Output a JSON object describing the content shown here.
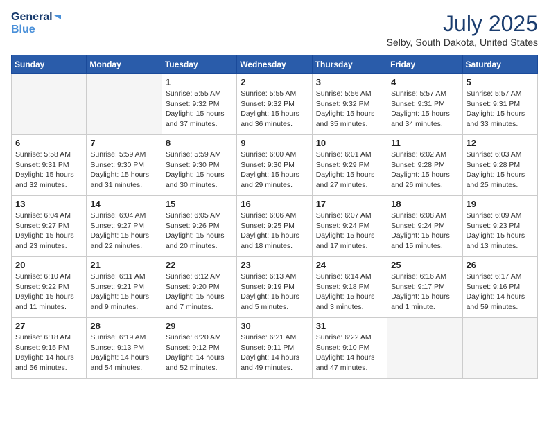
{
  "logo": {
    "line1": "General",
    "line2": "Blue"
  },
  "title": "July 2025",
  "location": "Selby, South Dakota, United States",
  "days_of_week": [
    "Sunday",
    "Monday",
    "Tuesday",
    "Wednesday",
    "Thursday",
    "Friday",
    "Saturday"
  ],
  "weeks": [
    [
      {
        "day": "",
        "info": ""
      },
      {
        "day": "",
        "info": ""
      },
      {
        "day": "1",
        "info": "Sunrise: 5:55 AM\nSunset: 9:32 PM\nDaylight: 15 hours\nand 37 minutes."
      },
      {
        "day": "2",
        "info": "Sunrise: 5:55 AM\nSunset: 9:32 PM\nDaylight: 15 hours\nand 36 minutes."
      },
      {
        "day": "3",
        "info": "Sunrise: 5:56 AM\nSunset: 9:32 PM\nDaylight: 15 hours\nand 35 minutes."
      },
      {
        "day": "4",
        "info": "Sunrise: 5:57 AM\nSunset: 9:31 PM\nDaylight: 15 hours\nand 34 minutes."
      },
      {
        "day": "5",
        "info": "Sunrise: 5:57 AM\nSunset: 9:31 PM\nDaylight: 15 hours\nand 33 minutes."
      }
    ],
    [
      {
        "day": "6",
        "info": "Sunrise: 5:58 AM\nSunset: 9:31 PM\nDaylight: 15 hours\nand 32 minutes."
      },
      {
        "day": "7",
        "info": "Sunrise: 5:59 AM\nSunset: 9:30 PM\nDaylight: 15 hours\nand 31 minutes."
      },
      {
        "day": "8",
        "info": "Sunrise: 5:59 AM\nSunset: 9:30 PM\nDaylight: 15 hours\nand 30 minutes."
      },
      {
        "day": "9",
        "info": "Sunrise: 6:00 AM\nSunset: 9:30 PM\nDaylight: 15 hours\nand 29 minutes."
      },
      {
        "day": "10",
        "info": "Sunrise: 6:01 AM\nSunset: 9:29 PM\nDaylight: 15 hours\nand 27 minutes."
      },
      {
        "day": "11",
        "info": "Sunrise: 6:02 AM\nSunset: 9:28 PM\nDaylight: 15 hours\nand 26 minutes."
      },
      {
        "day": "12",
        "info": "Sunrise: 6:03 AM\nSunset: 9:28 PM\nDaylight: 15 hours\nand 25 minutes."
      }
    ],
    [
      {
        "day": "13",
        "info": "Sunrise: 6:04 AM\nSunset: 9:27 PM\nDaylight: 15 hours\nand 23 minutes."
      },
      {
        "day": "14",
        "info": "Sunrise: 6:04 AM\nSunset: 9:27 PM\nDaylight: 15 hours\nand 22 minutes."
      },
      {
        "day": "15",
        "info": "Sunrise: 6:05 AM\nSunset: 9:26 PM\nDaylight: 15 hours\nand 20 minutes."
      },
      {
        "day": "16",
        "info": "Sunrise: 6:06 AM\nSunset: 9:25 PM\nDaylight: 15 hours\nand 18 minutes."
      },
      {
        "day": "17",
        "info": "Sunrise: 6:07 AM\nSunset: 9:24 PM\nDaylight: 15 hours\nand 17 minutes."
      },
      {
        "day": "18",
        "info": "Sunrise: 6:08 AM\nSunset: 9:24 PM\nDaylight: 15 hours\nand 15 minutes."
      },
      {
        "day": "19",
        "info": "Sunrise: 6:09 AM\nSunset: 9:23 PM\nDaylight: 15 hours\nand 13 minutes."
      }
    ],
    [
      {
        "day": "20",
        "info": "Sunrise: 6:10 AM\nSunset: 9:22 PM\nDaylight: 15 hours\nand 11 minutes."
      },
      {
        "day": "21",
        "info": "Sunrise: 6:11 AM\nSunset: 9:21 PM\nDaylight: 15 hours\nand 9 minutes."
      },
      {
        "day": "22",
        "info": "Sunrise: 6:12 AM\nSunset: 9:20 PM\nDaylight: 15 hours\nand 7 minutes."
      },
      {
        "day": "23",
        "info": "Sunrise: 6:13 AM\nSunset: 9:19 PM\nDaylight: 15 hours\nand 5 minutes."
      },
      {
        "day": "24",
        "info": "Sunrise: 6:14 AM\nSunset: 9:18 PM\nDaylight: 15 hours\nand 3 minutes."
      },
      {
        "day": "25",
        "info": "Sunrise: 6:16 AM\nSunset: 9:17 PM\nDaylight: 15 hours\nand 1 minute."
      },
      {
        "day": "26",
        "info": "Sunrise: 6:17 AM\nSunset: 9:16 PM\nDaylight: 14 hours\nand 59 minutes."
      }
    ],
    [
      {
        "day": "27",
        "info": "Sunrise: 6:18 AM\nSunset: 9:15 PM\nDaylight: 14 hours\nand 56 minutes."
      },
      {
        "day": "28",
        "info": "Sunrise: 6:19 AM\nSunset: 9:13 PM\nDaylight: 14 hours\nand 54 minutes."
      },
      {
        "day": "29",
        "info": "Sunrise: 6:20 AM\nSunset: 9:12 PM\nDaylight: 14 hours\nand 52 minutes."
      },
      {
        "day": "30",
        "info": "Sunrise: 6:21 AM\nSunset: 9:11 PM\nDaylight: 14 hours\nand 49 minutes."
      },
      {
        "day": "31",
        "info": "Sunrise: 6:22 AM\nSunset: 9:10 PM\nDaylight: 14 hours\nand 47 minutes."
      },
      {
        "day": "",
        "info": ""
      },
      {
        "day": "",
        "info": ""
      }
    ]
  ]
}
